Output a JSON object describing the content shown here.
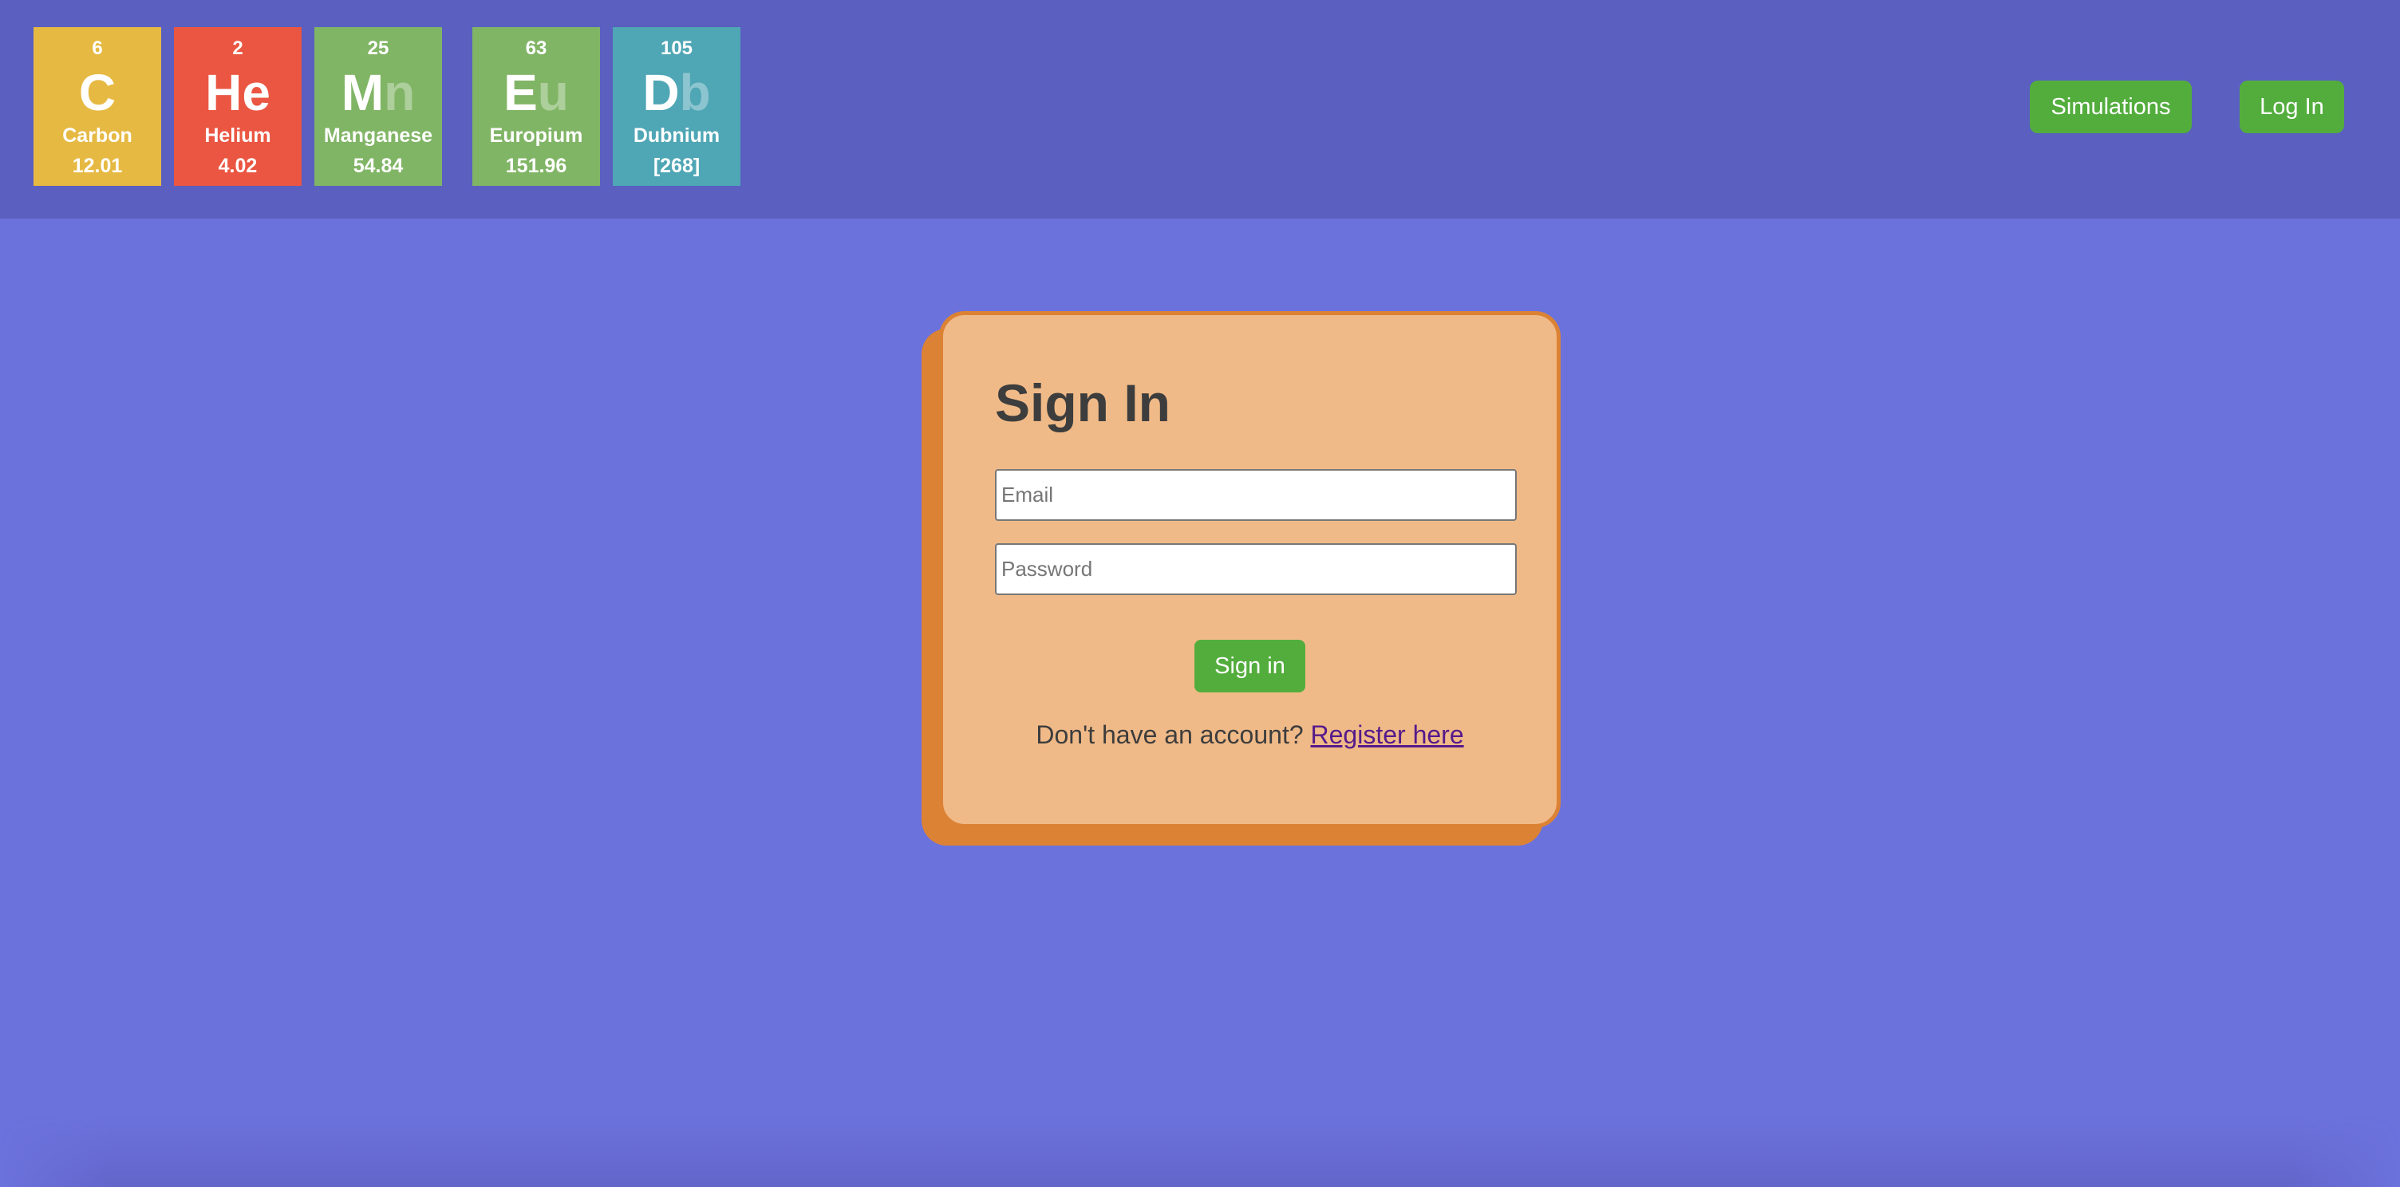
{
  "header": {
    "logo_tiles": [
      {
        "number": "6",
        "symbol_main": "C",
        "symbol_faded": "",
        "name": "Carbon",
        "mass": "12.01",
        "color": "#e6b943"
      },
      {
        "number": "2",
        "symbol_main": "He",
        "symbol_faded": "",
        "name": "Helium",
        "mass": "4.02",
        "color": "#ea5642"
      },
      {
        "number": "25",
        "symbol_main": "M",
        "symbol_faded": "n",
        "name": "Manganese",
        "mass": "54.84",
        "color": "#81b566"
      },
      {
        "number": "63",
        "symbol_main": "E",
        "symbol_faded": "u",
        "name": "Europium",
        "mass": "151.96",
        "color": "#81b566"
      },
      {
        "number": "105",
        "symbol_main": "D",
        "symbol_faded": "b",
        "name": "Dubnium",
        "mass": "[268]",
        "color": "#4fa6b5"
      }
    ],
    "nav": {
      "simulations_label": "Simulations",
      "login_label": "Log In"
    }
  },
  "signin": {
    "title": "Sign In",
    "email_placeholder": "Email",
    "email_value": "",
    "password_placeholder": "Password",
    "password_value": "",
    "submit_label": "Sign in",
    "register_prompt": "Don't have an account?",
    "register_link": "Register here"
  },
  "colors": {
    "header_bg": "#5a5fc0",
    "page_bg": "#6c72dc",
    "button_green": "#53ad3d",
    "card_bg": "#f0ba88",
    "card_accent": "#dc8235",
    "link": "#551a8b"
  }
}
